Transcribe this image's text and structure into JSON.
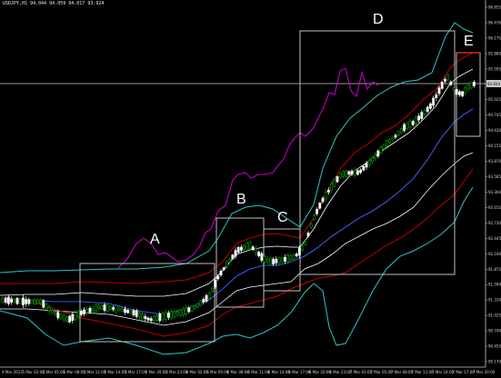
{
  "chart_header": "USDJPY,H1 94.044 94.059 94.017 93.924",
  "colors": {
    "background": "#000000",
    "candle_up": "#00a000",
    "candle_down": "#ffffff",
    "bb_outer": "#2ec4c4",
    "bb_mid": "#c00000",
    "bb_inner": "#ffffff",
    "ma": "#3b55e0",
    "momentum": "#c000c0",
    "zone_box": "#c0c0c0",
    "zone_e_top": "#ff3030",
    "gridline": "#c8c8c8"
  },
  "zone_labels": {
    "a": "A",
    "b": "B",
    "c": "C",
    "d": "D",
    "e": "E"
  },
  "y_axis": {
    "price_current": "93.924",
    "ticks": [
      "96.655",
      "96.476",
      "96.175",
      "95.880",
      "95.595",
      "95.310",
      "95.025",
      "94.745",
      "94.430",
      "94.155",
      "93.870",
      "93.585",
      "93.300",
      "93.015",
      "92.730",
      "92.445",
      "92.160",
      "91.875",
      "91.590",
      "91.310",
      "91.025",
      "90.740",
      "90.455",
      "90.170"
    ]
  },
  "x_axis": {
    "ticks": [
      "4 Mar 2013",
      "5 Mar 02:00",
      "5 Mar 05:00",
      "5 Mar 08:00",
      "5 Mar 11:00",
      "5 Mar 14:00",
      "5 Mar 17:00",
      "5 Mar 20:00",
      "5 Mar 23:00",
      "6 Mar 02:00",
      "6 Mar 05:00",
      "6 Mar 08:00",
      "6 Mar 11:00",
      "6 Mar 14:00",
      "6 Mar 17:00",
      "6 Mar 20:00",
      "6 Mar 23:00",
      "7 Mar 02:00",
      "7 Mar 05:00",
      "7 Mar 08:00",
      "7 Mar 11:00",
      "7 Mar 14:00",
      "7 Mar 17:00",
      "7 Mar 20:00"
    ]
  }
}
